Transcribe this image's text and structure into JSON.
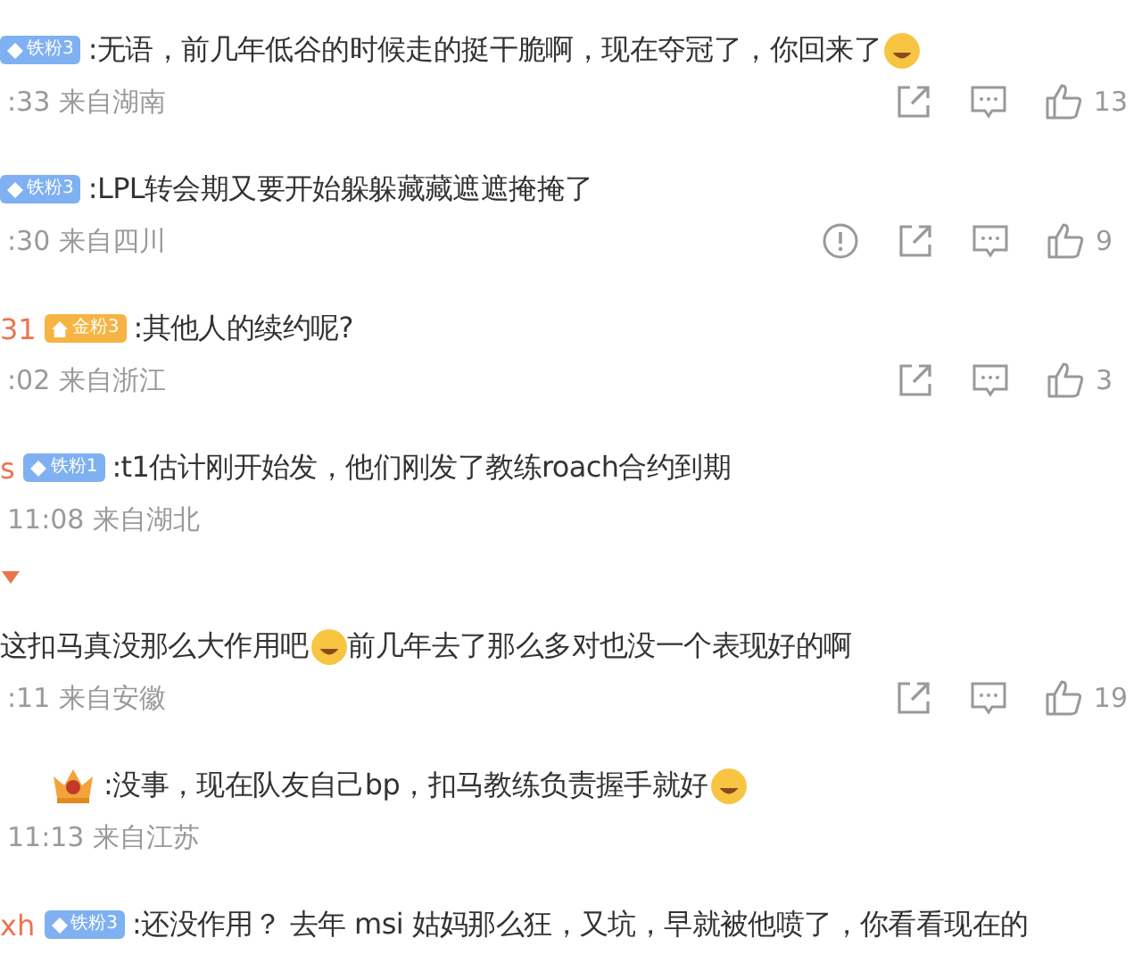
{
  "comments": [
    {
      "badge": {
        "kind": "iron",
        "label": "铁粉3"
      },
      "parts": [
        {
          "kind": "text",
          "text": ":无语，前几年低谷的时候走的挺干脆啊，现在夺冠了，你回来了"
        },
        {
          "kind": "emoji"
        }
      ],
      "meta": ":33 来自湖南",
      "actions": [
        {
          "kind": "share"
        },
        {
          "kind": "comment"
        },
        {
          "kind": "like",
          "count": "13"
        }
      ]
    },
    {
      "badge": {
        "kind": "iron",
        "label": "铁粉3"
      },
      "parts": [
        {
          "kind": "text",
          "text": ":LPL转会期又要开始躲躲藏藏遮遮掩掩了"
        }
      ],
      "meta": ":30 来自四川",
      "actions": [
        {
          "kind": "report"
        },
        {
          "kind": "share"
        },
        {
          "kind": "comment"
        },
        {
          "kind": "like",
          "count": "9"
        }
      ]
    },
    {
      "name": "31",
      "badge": {
        "kind": "gold",
        "label": "金粉3"
      },
      "parts": [
        {
          "kind": "text",
          "text": ":其他人的续约呢?"
        }
      ],
      "meta": ":02 来自浙江",
      "actions": [
        {
          "kind": "share"
        },
        {
          "kind": "comment"
        },
        {
          "kind": "like",
          "count": "3"
        }
      ]
    },
    {
      "name": "s",
      "badge": {
        "kind": "iron",
        "label": "铁粉1"
      },
      "parts": [
        {
          "kind": "text",
          "text": ":t1估计刚开始发，他们刚发了教练roach合约到期"
        }
      ],
      "meta": "11:08 来自湖北",
      "expand": true
    },
    {
      "parts": [
        {
          "kind": "text",
          "text": "这扣马真没那么大作用吧"
        },
        {
          "kind": "emoji"
        },
        {
          "kind": "text",
          "text": "前几年去了那么多对也没一个表现好的啊"
        }
      ],
      "meta": ":11 来自安徽",
      "actions": [
        {
          "kind": "share"
        },
        {
          "kind": "comment"
        },
        {
          "kind": "like",
          "count": "19"
        }
      ]
    },
    {
      "badge": {
        "kind": "crown"
      },
      "parts": [
        {
          "kind": "text",
          "text": ":没事，现在队友自己bp，扣马教练负责握手就好"
        },
        {
          "kind": "emoji"
        }
      ],
      "meta": "11:13 来自江苏"
    },
    {
      "name": "xh",
      "badge": {
        "kind": "iron",
        "label": "铁粉3"
      },
      "parts": [
        {
          "kind": "text",
          "text": ":还没作用？ 去年 msi 姑妈那么狂，又坑，早就被他喷了，你看看现在的"
        }
      ]
    }
  ]
}
